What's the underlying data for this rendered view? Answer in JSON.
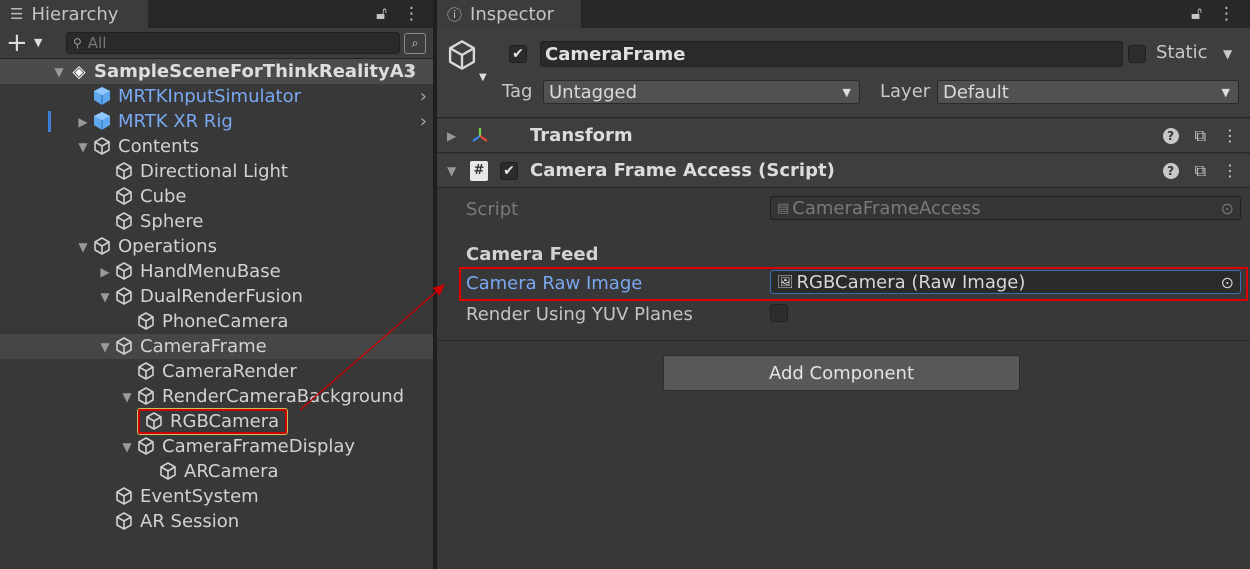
{
  "hierarchy": {
    "tab_label": "Hierarchy",
    "tab_icon": "list-icon",
    "search_placeholder": "All",
    "scene_name": "SampleSceneForThinkRealityA3",
    "items": [
      {
        "label": "MRTKInputSimulator"
      },
      {
        "label": "MRTK XR Rig"
      },
      {
        "label": "Contents"
      },
      {
        "label": "Directional Light"
      },
      {
        "label": "Cube"
      },
      {
        "label": "Sphere"
      },
      {
        "label": "Operations"
      },
      {
        "label": "HandMenuBase"
      },
      {
        "label": "DualRenderFusion"
      },
      {
        "label": "PhoneCamera"
      },
      {
        "label": "CameraFrame"
      },
      {
        "label": "CameraRender"
      },
      {
        "label": "RenderCameraBackground"
      },
      {
        "label": "RGBCamera"
      },
      {
        "label": "CameraFrameDisplay"
      },
      {
        "label": "ARCamera"
      },
      {
        "label": "EventSystem"
      },
      {
        "label": "AR Session"
      }
    ]
  },
  "inspector": {
    "tab_label": "Inspector",
    "object_name": "CameraFrame",
    "static_label": "Static",
    "tag_label": "Tag",
    "tag_value": "Untagged",
    "layer_label": "Layer",
    "layer_value": "Default",
    "components": [
      {
        "title": "Transform"
      },
      {
        "title": "Camera Frame Access (Script)"
      }
    ],
    "script_label": "Script",
    "script_value": "CameraFrameAccess",
    "section_header": "Camera Feed",
    "raw_image_label": "Camera Raw Image",
    "raw_image_value": "RGBCamera (Raw Image)",
    "yuv_label": "Render Using YUV Planes",
    "add_component_label": "Add Component"
  },
  "colors": {
    "annotation": "#d00000",
    "prefab_text": "#7aa8f2",
    "panel_bg": "#383838"
  }
}
